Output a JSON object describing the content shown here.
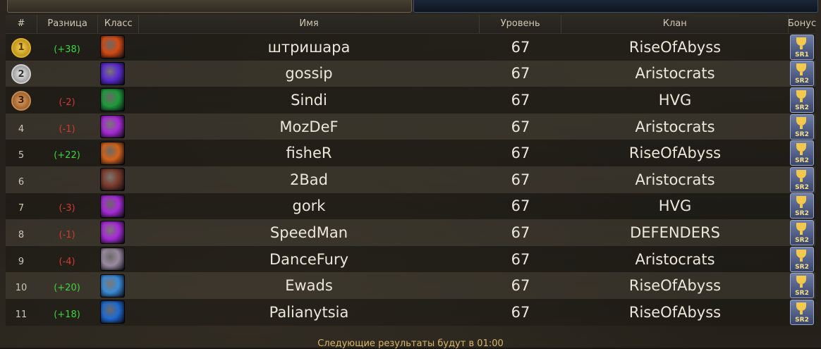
{
  "tabs": {
    "left": "",
    "right": ""
  },
  "headers": {
    "num": "#",
    "diff": "Разница",
    "cls": "Класс",
    "name": "Имя",
    "level": "Уровень",
    "clan": "Клан",
    "bonus": "Бонус"
  },
  "rows": [
    {
      "rank": "1",
      "medal": "gold",
      "diff": "(+38)",
      "dir": "up",
      "cls_color": "#d24a14",
      "name": "штришара",
      "level": "67",
      "clan": "RiseOfAbyss",
      "bonus": "SR1"
    },
    {
      "rank": "2",
      "medal": "silver",
      "diff": "",
      "dir": "",
      "cls_color": "#5a2ad0",
      "name": "gossip",
      "level": "67",
      "clan": "Aristocrats",
      "bonus": "SR2"
    },
    {
      "rank": "3",
      "medal": "bronze",
      "diff": "(-2)",
      "dir": "down",
      "cls_color": "#1e9a3a",
      "name": "Sindi",
      "level": "67",
      "clan": "HVG",
      "bonus": "SR2"
    },
    {
      "rank": "4",
      "medal": "",
      "diff": "(-1)",
      "dir": "down",
      "cls_color": "#a62ad6",
      "name": "MozDeF",
      "level": "67",
      "clan": "Aristocrats",
      "bonus": "SR2"
    },
    {
      "rank": "5",
      "medal": "",
      "diff": "(+22)",
      "dir": "up",
      "cls_color": "#d2621a",
      "name": "fisheR",
      "level": "67",
      "clan": "RiseOfAbyss",
      "bonus": "SR2"
    },
    {
      "rank": "6",
      "medal": "",
      "diff": "",
      "dir": "",
      "cls_color": "#7a3a2a",
      "name": "2Bad",
      "level": "67",
      "clan": "Aristocrats",
      "bonus": "SR2"
    },
    {
      "rank": "7",
      "medal": "",
      "diff": "(-3)",
      "dir": "down",
      "cls_color": "#a62ad6",
      "name": "gork",
      "level": "67",
      "clan": "HVG",
      "bonus": "SR2"
    },
    {
      "rank": "8",
      "medal": "",
      "diff": "(-1)",
      "dir": "down",
      "cls_color": "#a62ad6",
      "name": "SpeedMan",
      "level": "67",
      "clan": "DEFENDERS",
      "bonus": "SR2"
    },
    {
      "rank": "9",
      "medal": "",
      "diff": "(-4)",
      "dir": "down",
      "cls_color": "#9a8aa0",
      "name": "DanceFury",
      "level": "67",
      "clan": "Aristocrats",
      "bonus": "SR2"
    },
    {
      "rank": "10",
      "medal": "",
      "diff": "(+20)",
      "dir": "up",
      "cls_color": "#3a8ad6",
      "name": "Ewads",
      "level": "67",
      "clan": "RiseOfAbyss",
      "bonus": "SR2"
    },
    {
      "rank": "11",
      "medal": "",
      "diff": "(+18)",
      "dir": "up",
      "cls_color": "#1e6ad0",
      "name": "Palianytsia",
      "level": "67",
      "clan": "RiseOfAbyss",
      "bonus": "SR2"
    }
  ],
  "footer": "Следующие результаты будут в 01:00"
}
